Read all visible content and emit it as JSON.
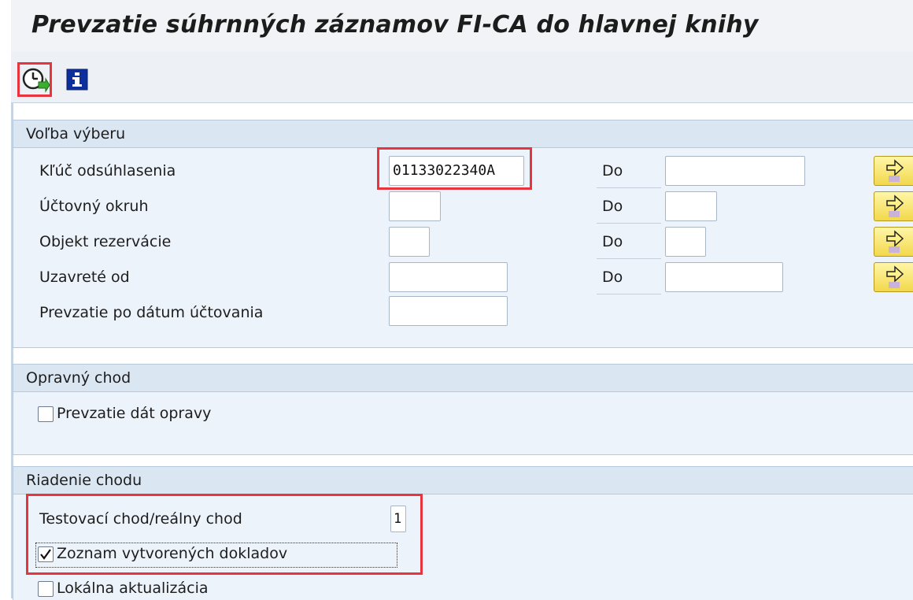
{
  "window": {
    "title": "Prevzatie súhrnných záznamov FI-CA do hlavnej knihy"
  },
  "toolbar": {
    "execute_icon": "execute-clock-icon",
    "info_icon": "info-icon"
  },
  "selection": {
    "header": "Voľba výberu",
    "to_label": "Do",
    "rows": [
      {
        "label": "Kľúč odsúhlasenia",
        "from_value": "01133022340A",
        "to_value": ""
      },
      {
        "label": "Účtovný okruh",
        "from_value": "",
        "to_value": ""
      },
      {
        "label": "Objekt rezervácie",
        "from_value": "",
        "to_value": ""
      },
      {
        "label": "Uzavreté od",
        "from_value": "",
        "to_value": ""
      },
      {
        "label": "Prevzatie po dátum účtovania",
        "from_value": ""
      }
    ]
  },
  "correction": {
    "header": "Opravný chod",
    "checkbox_label": "Prevzatie dát opravy",
    "checked": false
  },
  "run_control": {
    "header": "Riadenie chodu",
    "test_run_label": "Testovací chod/reálny chod",
    "test_run_value": "1",
    "doc_list_label": "Zoznam vytvorených dokladov",
    "doc_list_checked": true,
    "local_update_label": "Lokálna aktualizácia",
    "local_update_checked": false
  },
  "colors": {
    "highlight": "#e8343c",
    "group_header_bg": "#dbe6f3",
    "group_bg": "#edf3fa",
    "arrow_button": "#f7e46a"
  }
}
